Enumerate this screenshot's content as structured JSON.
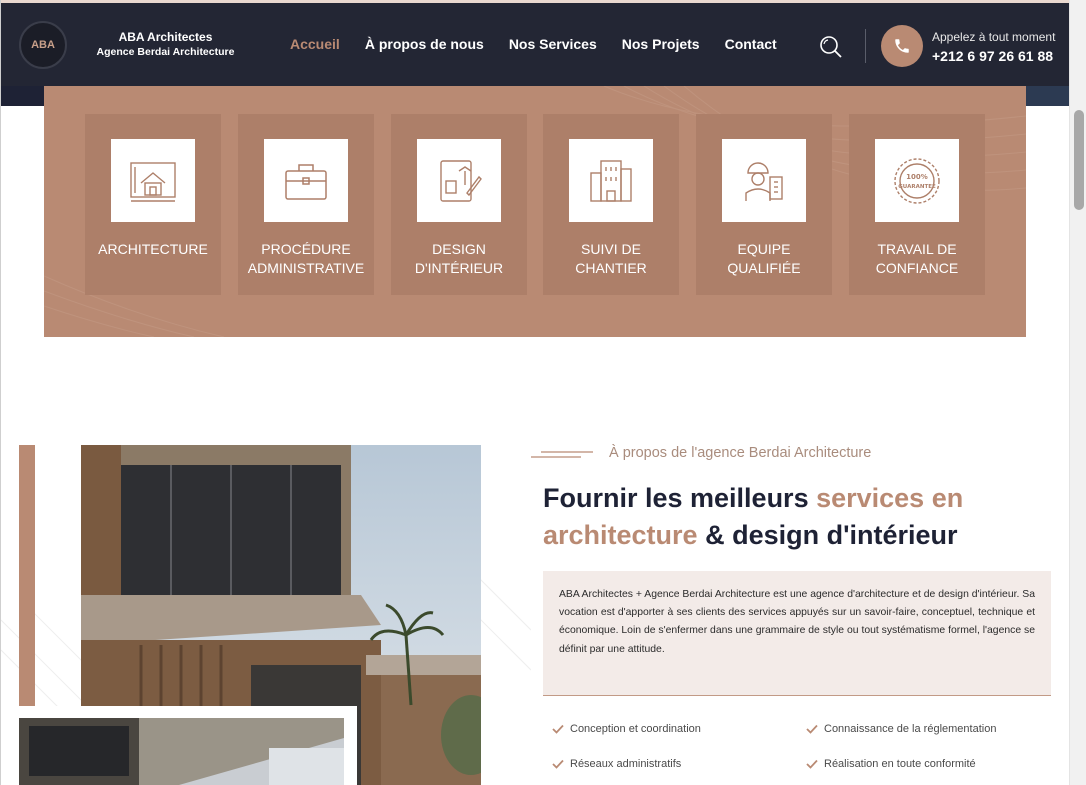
{
  "header": {
    "logo_text": "ABA",
    "brand_name": "ABA Architectes",
    "brand_tagline": "Agence Berdai Architecture",
    "nav": [
      {
        "label": "Accueil",
        "active": true
      },
      {
        "label": "À propos de nous"
      },
      {
        "label": "Nos Services"
      },
      {
        "label": "Nos Projets"
      },
      {
        "label": "Contact"
      }
    ],
    "search_icon": "search-icon",
    "call_label": "Appelez à tout moment",
    "phone_number": "+212 6 97 26 61 88"
  },
  "services": [
    {
      "label1": "ARCHITECTURE",
      "label2": "",
      "icon": "blueprint-house-icon"
    },
    {
      "label1": "PROCÉDURE",
      "label2": "ADMINISTRATIVE",
      "icon": "briefcase-icon"
    },
    {
      "label1": "DESIGN",
      "label2": "D'INTÉRIEUR",
      "icon": "interior-design-icon"
    },
    {
      "label1": "SUIVI DE",
      "label2": "CHANTIER",
      "icon": "building-icon"
    },
    {
      "label1": "EQUIPE",
      "label2": "QUALIFIÉE",
      "icon": "engineer-icon"
    },
    {
      "label1": "TRAVAIL DE",
      "label2": "CONFIANCE",
      "icon": "guarantee-badge-icon"
    }
  ],
  "about": {
    "kicker": "À propos de l'agence Berdai Architecture",
    "heading_part1": "Fournir les meilleurs ",
    "heading_accent1": "services en architecture",
    "heading_part2": " & design d'intérieur",
    "description": "ABA Architectes + Agence Berdai Architecture est une agence d'architecture et de design d'intérieur. Sa vocation est d'apporter à ses clients des services appuyés sur un savoir-faire, conceptuel, technique et économique. Loin de s'enfermer dans une grammaire de style ou tout systématisme formel, l'agence se définit par une attitude.",
    "features": [
      "Conception et coordination",
      "Connaissance de la réglementation",
      "Réseaux administratifs",
      "Réalisation en toute conformité"
    ]
  },
  "colors": {
    "accent": "#b98a73",
    "dark": "#232634",
    "card": "#ad7f69",
    "desc_bg": "#f3ebe8"
  }
}
